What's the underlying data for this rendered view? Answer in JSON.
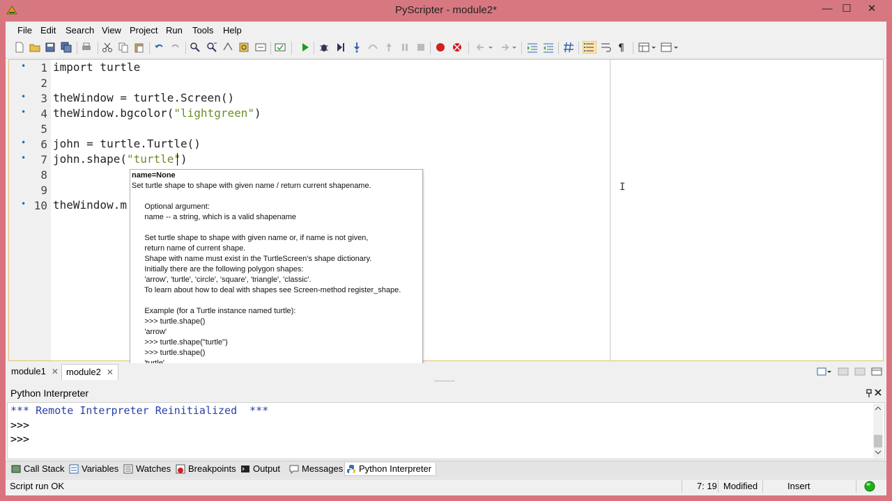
{
  "window": {
    "title": "PyScripter - module2*",
    "minimize_glyph": "—",
    "maximize_glyph": "☐",
    "close_glyph": "✕"
  },
  "menu": [
    "File",
    "Edit",
    "Search",
    "View",
    "Project",
    "Run",
    "Tools",
    "Help"
  ],
  "editor": {
    "lines": [
      {
        "num": "1",
        "marker": true,
        "text": "import turtle"
      },
      {
        "num": "2",
        "marker": false,
        "text": ""
      },
      {
        "num": "3",
        "marker": true,
        "text": "theWindow = turtle.Screen()"
      },
      {
        "num": "4",
        "marker": true,
        "pre": "theWindow.bgcolor(",
        "str": "\"lightgreen\"",
        "post": ")"
      },
      {
        "num": "5",
        "marker": false,
        "text": ""
      },
      {
        "num": "6",
        "marker": true,
        "text": "john = turtle.Turtle()"
      },
      {
        "num": "7",
        "marker": true,
        "pre": "john.shape(",
        "str": "\"turtle\"",
        "post": ")"
      },
      {
        "num": "8",
        "marker": false,
        "text": ""
      },
      {
        "num": "9",
        "marker": false,
        "text": ""
      },
      {
        "num": "10",
        "marker": true,
        "text": "theWindow.m"
      }
    ]
  },
  "tooltip": {
    "signature": "name=None",
    "doc": "Set turtle shape to shape with given name / return current shapename.\n\n      Optional argument:\n      name -- a string, which is a valid shapename\n\n      Set turtle shape to shape with given name or, if name is not given,\n      return name of current shape.\n      Shape with name must exist in the TurtleScreen's shape dictionary.\n      Initially there are the following polygon shapes:\n      'arrow', 'turtle', 'circle', 'square', 'triangle', 'classic'.\n      To learn about how to deal with shapes see Screen-method register_shape.\n\n      Example (for a Turtle instance named turtle):\n      >>> turtle.shape()\n      'arrow'\n      >>> turtle.shape(\"turtle\")\n      >>> turtle.shape()\n      'turtle'"
  },
  "editor_tabs": [
    {
      "label": "module1",
      "close": "✕"
    },
    {
      "label": "module2",
      "close": "✕"
    }
  ],
  "interpreter": {
    "title": "Python Interpreter",
    "lines": [
      "*** Remote Interpreter Reinitialized  ***",
      ">>>",
      ">>>"
    ]
  },
  "bottom_tabs": [
    "Call Stack",
    "Variables",
    "Watches",
    "Breakpoints",
    "Output",
    "Messages",
    "Python Interpreter"
  ],
  "status": {
    "message": "Script run OK",
    "position": "7: 19",
    "modified": "Modified",
    "mode": "Insert"
  },
  "colors": {
    "titlebar": "#d77880",
    "string": "#6b8e23",
    "interpreter_banner": "#2a3fa8",
    "run_green": "#1a9e1a",
    "breakpoint_red": "#d02020"
  }
}
